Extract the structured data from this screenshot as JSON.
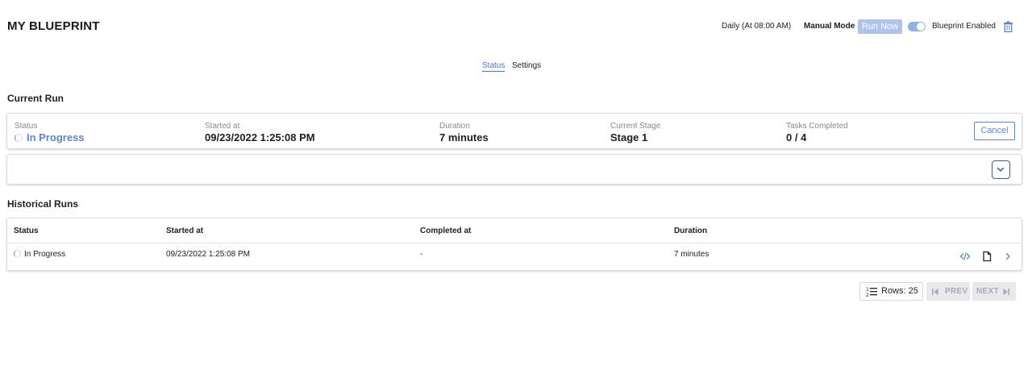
{
  "header": {
    "title": "MY BLUEPRINT",
    "schedule": "Daily (At 08:00 AM)",
    "mode": "Manual Mode",
    "run_now_label": "Run Now",
    "blueprint_enabled_label": "Blueprint Enabled",
    "blueprint_enabled": true
  },
  "tabs": [
    {
      "label": "Status",
      "active": true
    },
    {
      "label": "Settings",
      "active": false
    }
  ],
  "current_run": {
    "section_title": "Current Run",
    "status_label": "Status",
    "status_value": "In Progress",
    "started_label": "Started at",
    "started_value": "09/23/2022 1:25:08 PM",
    "duration_label": "Duration",
    "duration_value": "7 minutes",
    "stage_label": "Current Stage",
    "stage_value": "Stage 1",
    "tasks_label": "Tasks Completed",
    "tasks_value": "0 / 4",
    "cancel_label": "Cancel"
  },
  "historical_runs": {
    "section_title": "Historical Runs",
    "columns": [
      "Status",
      "Started at",
      "Completed at",
      "Duration"
    ],
    "rows": [
      {
        "status": "In Progress",
        "started": "09/23/2022 1:25:08 PM",
        "completed": "-",
        "duration": "7 minutes"
      }
    ]
  },
  "pagination": {
    "rows_label": "Rows: 25",
    "prev_label": "PREV",
    "next_label": "NEXT"
  },
  "colors": {
    "accent": "#5b86d1",
    "run_now_disabled": "#aec4ec",
    "toggle_on": "#8eb3e0",
    "pager_disabled": "#e7e9ec"
  }
}
